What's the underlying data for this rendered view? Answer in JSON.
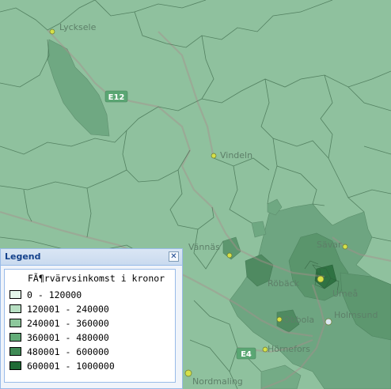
{
  "map": {
    "places": {
      "lycksele": "Lycksele",
      "vindeln": "Vindeln",
      "vannas": "Vännäs",
      "savar": "Sävar",
      "umea": "Umeå",
      "roback": "Röbäck",
      "obbola": "Obbola",
      "holmsund": "Holmsund",
      "hornefors": "Hörnefors",
      "nordmaling": "Nordmaling"
    },
    "roads": {
      "e12": "E12",
      "e4": "E4"
    }
  },
  "legend": {
    "title": "Legend",
    "close_symbol": "✕",
    "heading": "FÃ¶rvärvsinkomst i kronor",
    "classes": [
      {
        "label": "0 - 120000",
        "color": "#e4f6ea"
      },
      {
        "label": "120001 - 240000",
        "color": "#b7dfc2"
      },
      {
        "label": "240001 - 360000",
        "color": "#8dc89c"
      },
      {
        "label": "360001 - 480000",
        "color": "#63ad78"
      },
      {
        "label": "480001 - 600000",
        "color": "#3f8a55"
      },
      {
        "label": "600001 - 1000000",
        "color": "#1f6b35"
      }
    ]
  }
}
